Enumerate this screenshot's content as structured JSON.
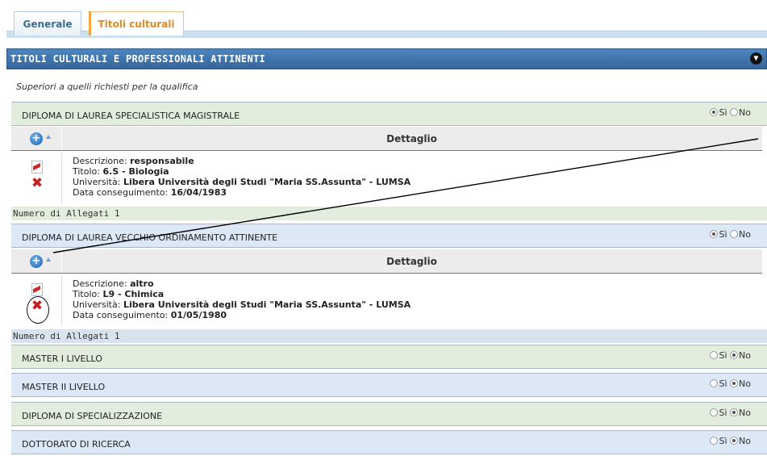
{
  "tabs": [
    {
      "label": "Generale"
    },
    {
      "label": "Titoli culturali"
    }
  ],
  "section": {
    "title": "TITOLI CULTURALI E PROFESSIONALI ATTINENTI",
    "subtitle": "Superiori a quelli richiesti per la qualifica"
  },
  "radio_labels": {
    "yes": "Sì",
    "no": "No"
  },
  "items": [
    {
      "title": "DIPLOMA DI LAUREA SPECIALISTICA MAGISTRALE",
      "selected": "yes",
      "detail_header": "Dettaglio",
      "detail": {
        "descrizione_label": "Descrizione:",
        "descrizione": "responsabile",
        "titolo_label": "Titolo:",
        "titolo": "6.S - Biologia",
        "universita_label": "Università:",
        "universita": "Libera Università degli Studi \"Maria SS.Assunta\" - LUMSA",
        "data_label": "Data conseguimento:",
        "data": "16/04/1983"
      },
      "attachments": "Numero di Allegati 1"
    },
    {
      "title": "DIPLOMA DI LAUREA VECCHIO ORDINAMENTO ATTINENTE",
      "selected": "yes",
      "detail_header": "Dettaglio",
      "detail": {
        "descrizione_label": "Descrizione:",
        "descrizione": "altro",
        "titolo_label": "Titolo:",
        "titolo": "L9 - Chimica",
        "universita_label": "Università:",
        "universita": "Libera Università degli Studi \"Maria SS.Assunta\" - LUMSA",
        "data_label": "Data conseguimento:",
        "data": "01/05/1980"
      },
      "attachments": "Numero di Allegati 1"
    },
    {
      "title": "MASTER I LIVELLO",
      "selected": "no"
    },
    {
      "title": "MASTER II LIVELLO",
      "selected": "no"
    },
    {
      "title": "DIPLOMA DI SPECIALIZZAZIONE",
      "selected": "no"
    },
    {
      "title": "DOTTORATO DI RICERCA",
      "selected": "no"
    }
  ],
  "icons": {
    "add": "plus-circle-icon",
    "sort": "sort-up-icon",
    "pdf": "pdf-icon",
    "delete": "delete-icon",
    "collapse": "chevron-down-icon"
  }
}
